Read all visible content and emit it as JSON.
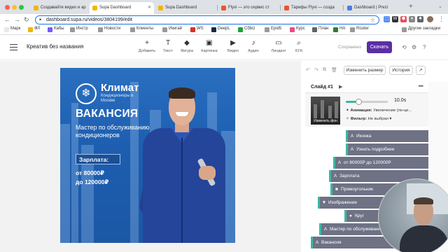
{
  "browser": {
    "tabs": [
      {
        "title": "Создавайте видео и ар",
        "favicon_color": "#f2b600"
      },
      {
        "title": "Supa Dashboard",
        "favicon_color": "#f2b600",
        "active": true
      },
      {
        "title": "Supa Dashboard",
        "favicon_color": "#f2b600"
      },
      {
        "title": "Flyvi — это сервис ст",
        "favicon_color": "#e8562a"
      },
      {
        "title": "Тарифы Flyvi — созда",
        "favicon_color": "#e8562a"
      },
      {
        "title": "Dashboard | Prezi",
        "favicon_color": "#4a7be8"
      }
    ],
    "url": "dashboard.supa.ru/videos/3804199/edit",
    "bookmarks": [
      {
        "label": "Марк",
        "color": "#e8e8e8"
      },
      {
        "label": "ФЛ",
        "color": "#f5b400"
      },
      {
        "label": "Кабы",
        "color": "#7a5af5"
      },
      {
        "label": "Инстр",
        "color": "#999999"
      },
      {
        "label": "Новости",
        "color": "#999999"
      },
      {
        "label": "Клиенты",
        "color": "#999999"
      },
      {
        "label": "Икигай",
        "color": "#999999"
      },
      {
        "label": "WS",
        "color": "#d93025"
      },
      {
        "label": "DeepL",
        "color": "#0f2b46"
      },
      {
        "label": "Сбbiz",
        "color": "#21a038"
      },
      {
        "label": "Epid5",
        "color": "#999999"
      },
      {
        "label": "Курс",
        "color": "#e94c89"
      },
      {
        "label": "План",
        "color": "#5f6368"
      },
      {
        "label": "НА",
        "color": "#2e7d32"
      },
      {
        "label": "Router",
        "color": "#999999"
      },
      {
        "label": "Другие закладки",
        "color": "#999999"
      }
    ]
  },
  "app": {
    "project_name": "Креатив без названия",
    "tools": [
      {
        "label": "Добавить",
        "icon": "+"
      },
      {
        "label": "Текст",
        "icon": "T"
      },
      {
        "label": "Фигура",
        "icon": "◆"
      },
      {
        "label": "Картинка",
        "icon": "▣"
      },
      {
        "label": "Видео",
        "icon": "▶"
      },
      {
        "label": "Аудио",
        "icon": "♪"
      },
      {
        "label": "Лендинг",
        "icon": "▭"
      },
      {
        "label": "91%",
        "icon": "⌕"
      }
    ],
    "saved_text": "Сохранено",
    "download_label": "Скачать",
    "accent": "#5a2ea6"
  },
  "banner": {
    "brand": "Климат",
    "brand_sub": "Кондиционеры в Москве",
    "title": "ВАКАНСИЯ",
    "description": "Мастер по обслуживанию кондиционеров",
    "salary_label": "Зарплата:",
    "salary_from": "от 80000₽",
    "salary_to": "до 120000₽"
  },
  "panel": {
    "resize_label": "Изменить размер",
    "history_label": "История",
    "slide_title": "Слайд #1",
    "duration": "10.0s",
    "duration_fraction": 0.3,
    "thumb_caption": "Изменить фон",
    "animation_label": "Анимация:",
    "animation_value": "Увеличение (по-це...",
    "filter_label": "Фильтр:",
    "filter_value": "Не выбран",
    "layers": [
      {
        "icon": "A",
        "label": "Иконка"
      },
      {
        "icon": "A",
        "label": "Узнать подробнее"
      },
      {
        "icon": "A",
        "label": "от 80000Р до 120000Р"
      },
      {
        "icon": "A",
        "label": "Зарплата"
      },
      {
        "icon": "■",
        "label": "Прямоугольник"
      },
      {
        "icon": "▼",
        "label": "Изображение"
      },
      {
        "icon": "●",
        "label": "Круг"
      },
      {
        "icon": "A",
        "label": "Мастер по обслуживанию"
      },
      {
        "icon": "A",
        "label": "Вакансия"
      }
    ]
  }
}
